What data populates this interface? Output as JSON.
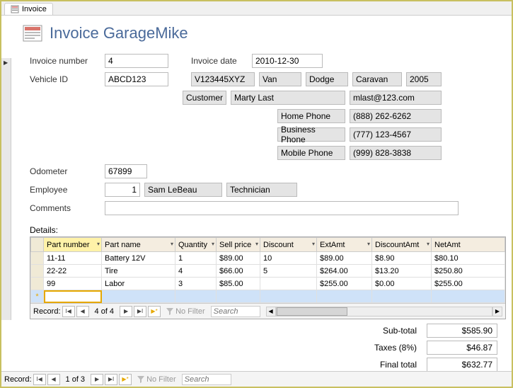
{
  "tab": {
    "label": "Invoice"
  },
  "header": {
    "title": "Invoice GarageMike"
  },
  "labels": {
    "invoice_number": "Invoice number",
    "invoice_date": "Invoice date",
    "vehicle_id": "Vehicle ID",
    "customer": "Customer",
    "home_phone": "Home Phone",
    "business_phone": "Business Phone",
    "mobile_phone": "Mobile Phone",
    "odometer": "Odometer",
    "employee": "Employee",
    "comments": "Comments",
    "details": "Details:",
    "subtotal": "Sub-total",
    "taxes": "Taxes (8%)",
    "final_total": "Final total"
  },
  "form": {
    "invoice_number": "4",
    "invoice_date": "2010-12-30",
    "vehicle_id": "ABCD123",
    "vin": "V123445XYZ",
    "body": "Van",
    "make": "Dodge",
    "model": "Caravan",
    "year": "2005",
    "customer_name": "Marty Last",
    "customer_email": "mlast@123.com",
    "home_phone": "(888) 262-6262",
    "business_phone": "(777) 123-4567",
    "mobile_phone": "(999) 828-3838",
    "odometer": "67899",
    "employee_id": "1",
    "employee_name": "Sam LeBeau",
    "employee_role": "Technician",
    "comments": ""
  },
  "grid": {
    "headers": {
      "part_number": "Part number",
      "part_name": "Part name",
      "quantity": "Quantity",
      "sell_price": "Sell price",
      "discount": "Discount",
      "ext_amt": "ExtAmt",
      "discount_amt": "DiscountAmt",
      "net_amt": "NetAmt"
    },
    "rows": [
      {
        "pn": "11-11",
        "name": "Battery 12V",
        "qty": "1",
        "price": "$89.00",
        "disc": "10",
        "ext": "$89.00",
        "damt": "$8.90",
        "net": "$80.10"
      },
      {
        "pn": "22-22",
        "name": "Tire",
        "qty": "4",
        "price": "$66.00",
        "disc": "5",
        "ext": "$264.00",
        "damt": "$13.20",
        "net": "$250.80"
      },
      {
        "pn": "99",
        "name": "Labor",
        "qty": "3",
        "price": "$85.00",
        "disc": "",
        "ext": "$255.00",
        "damt": "$0.00",
        "net": "$255.00"
      }
    ]
  },
  "totals": {
    "subtotal": "$585.90",
    "taxes": "$46.87",
    "final": "$632.77"
  },
  "nav": {
    "record_label": "Record:",
    "sub_pos": "4 of 4",
    "main_pos": "1 of 3",
    "no_filter": "No Filter",
    "search_placeholder": "Search"
  }
}
